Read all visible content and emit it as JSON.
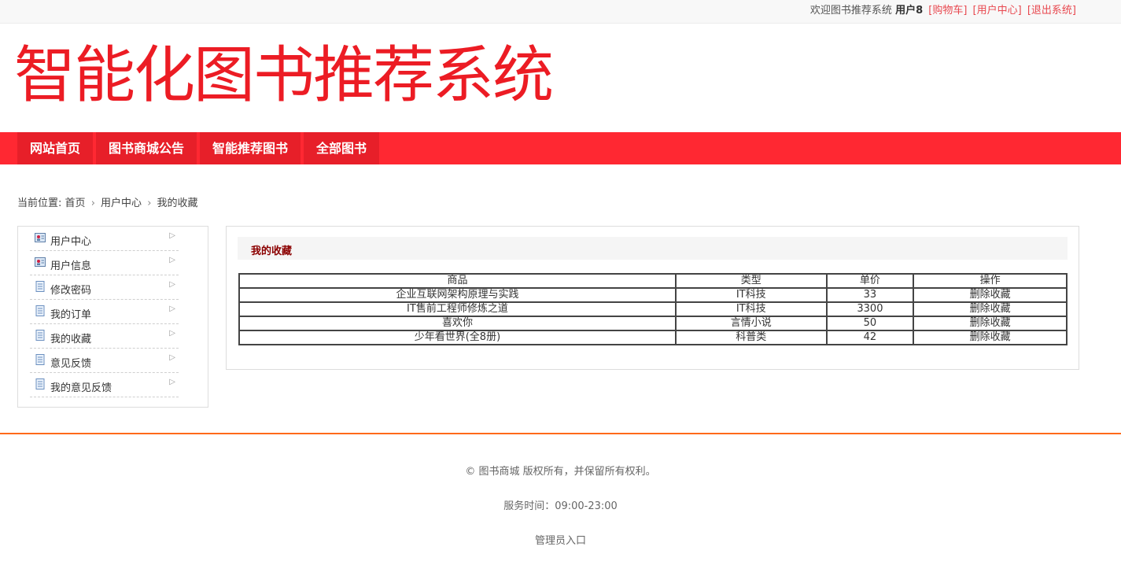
{
  "topbar": {
    "welcome": "欢迎图书推荐系统",
    "username": "用户8",
    "links": [
      "[购物车]",
      "[用户中心]",
      "[退出系统]"
    ]
  },
  "header": {
    "title": "智能化图书推荐系统"
  },
  "nav": {
    "items": [
      "网站首页",
      "图书商城公告",
      "智能推荐图书",
      "全部图书"
    ]
  },
  "breadcrumb": {
    "prefix": "当前位置:",
    "items": [
      "首页",
      "用户中心",
      "我的收藏"
    ],
    "separator": "›"
  },
  "sidebar": {
    "items": [
      {
        "label": "用户中心",
        "icon": "user-card-icon"
      },
      {
        "label": "用户信息",
        "icon": "user-card-icon"
      },
      {
        "label": "修改密码",
        "icon": "document-icon"
      },
      {
        "label": "我的订单",
        "icon": "document-icon"
      },
      {
        "label": "我的收藏",
        "icon": "document-icon"
      },
      {
        "label": "意见反馈",
        "icon": "document-icon"
      },
      {
        "label": "我的意见反馈",
        "icon": "document-icon"
      }
    ]
  },
  "main": {
    "title": "我的收藏",
    "table": {
      "headers": [
        "商品",
        "类型",
        "单价",
        "操作"
      ],
      "rows": [
        [
          "企业互联网架构原理与实践",
          "IT科技",
          "33",
          "删除收藏"
        ],
        [
          "IT售前工程师修炼之道",
          "IT科技",
          "3300",
          "删除收藏"
        ],
        [
          "喜欢你",
          "言情小说",
          "50",
          "删除收藏"
        ],
        [
          "少年看世界(全8册)",
          "科普类",
          "42",
          "删除收藏"
        ]
      ]
    }
  },
  "footer": {
    "copyright": "© 图书商城 版权所有，并保留所有权利。",
    "hours": "服务时间：09:00-23:00",
    "admin": "管理员入口"
  },
  "colors": {
    "brand_red": "#ec1c24",
    "nav_bg": "#ff2832",
    "nav_item": "#e71f29",
    "footer_line": "#ff6a1a"
  }
}
